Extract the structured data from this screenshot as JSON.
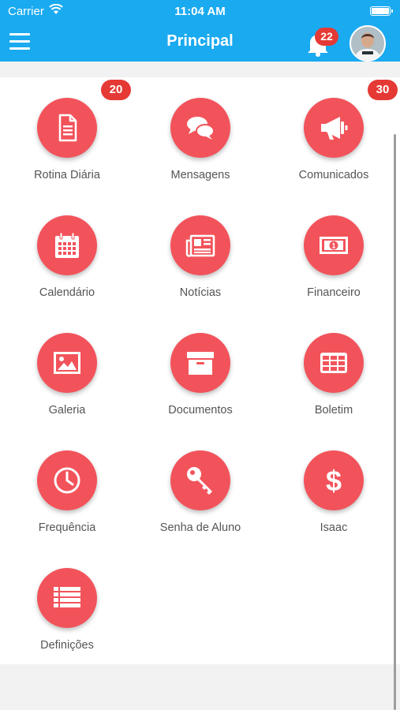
{
  "status_bar": {
    "carrier": "Carrier",
    "time": "11:04 AM"
  },
  "header": {
    "title": "Principal",
    "notification_count": "22"
  },
  "colors": {
    "header": "#1aaaf0",
    "tile": "#f2535b",
    "badge": "#e53935"
  },
  "tiles": [
    {
      "label": "Rotina Diária",
      "icon": "document-icon",
      "badge": "20"
    },
    {
      "label": "Mensagens",
      "icon": "chat-bubbles-icon"
    },
    {
      "label": "Comunicados",
      "icon": "megaphone-icon",
      "badge": "30"
    },
    {
      "label": "Calendário",
      "icon": "calendar-icon"
    },
    {
      "label": "Notícias",
      "icon": "newspaper-icon"
    },
    {
      "label": "Financeiro",
      "icon": "banknote-icon"
    },
    {
      "label": "Galeria",
      "icon": "image-icon"
    },
    {
      "label": "Documentos",
      "icon": "archive-box-icon"
    },
    {
      "label": "Boletim",
      "icon": "grid-table-icon"
    },
    {
      "label": "Frequência",
      "icon": "clock-icon"
    },
    {
      "label": "Senha de Aluno",
      "icon": "key-icon"
    },
    {
      "label": "Isaac",
      "icon": "dollar-icon"
    },
    {
      "label": "Definições",
      "icon": "list-icon"
    }
  ]
}
